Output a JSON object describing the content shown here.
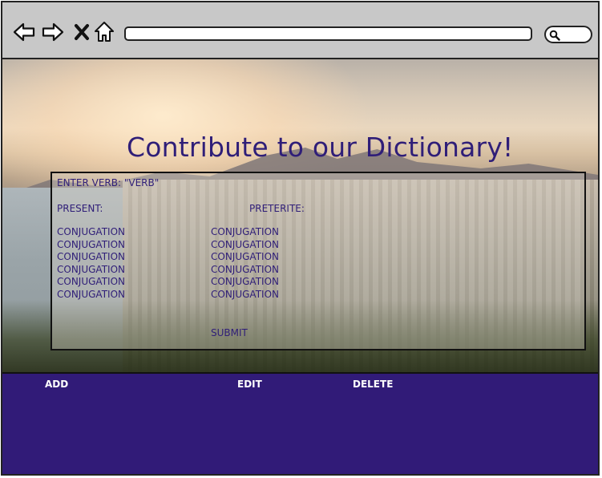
{
  "hero": {
    "title": "Contribute to our Dictionary!"
  },
  "form": {
    "verb_prompt": "ENTER VERB: \"VERB\"",
    "present_label": "PRESENT:",
    "preterite_label": "PRETERITE:",
    "present_conjugations": [
      "CONJUGATION",
      "CONJUGATION",
      "CONJUGATION",
      "CONJUGATION",
      "CONJUGATION",
      "CONJUGATION"
    ],
    "preterite_conjugations": [
      "CONJUGATION",
      "CONJUGATION",
      "CONJUGATION",
      "CONJUGATION",
      "CONJUGATION",
      "CONJUGATION"
    ],
    "submit_label": "SUBMIT"
  },
  "footer": {
    "add_label": "ADD",
    "edit_label": "EDIT",
    "delete_label": "DELETE"
  },
  "icons": {
    "back": "arrow-left-icon",
    "forward": "arrow-right-icon",
    "stop": "close-icon",
    "home": "home-icon",
    "search": "search-icon"
  },
  "colors": {
    "accent": "#311b78",
    "title": "#2f1e78",
    "chrome": "#c8c8c8"
  }
}
